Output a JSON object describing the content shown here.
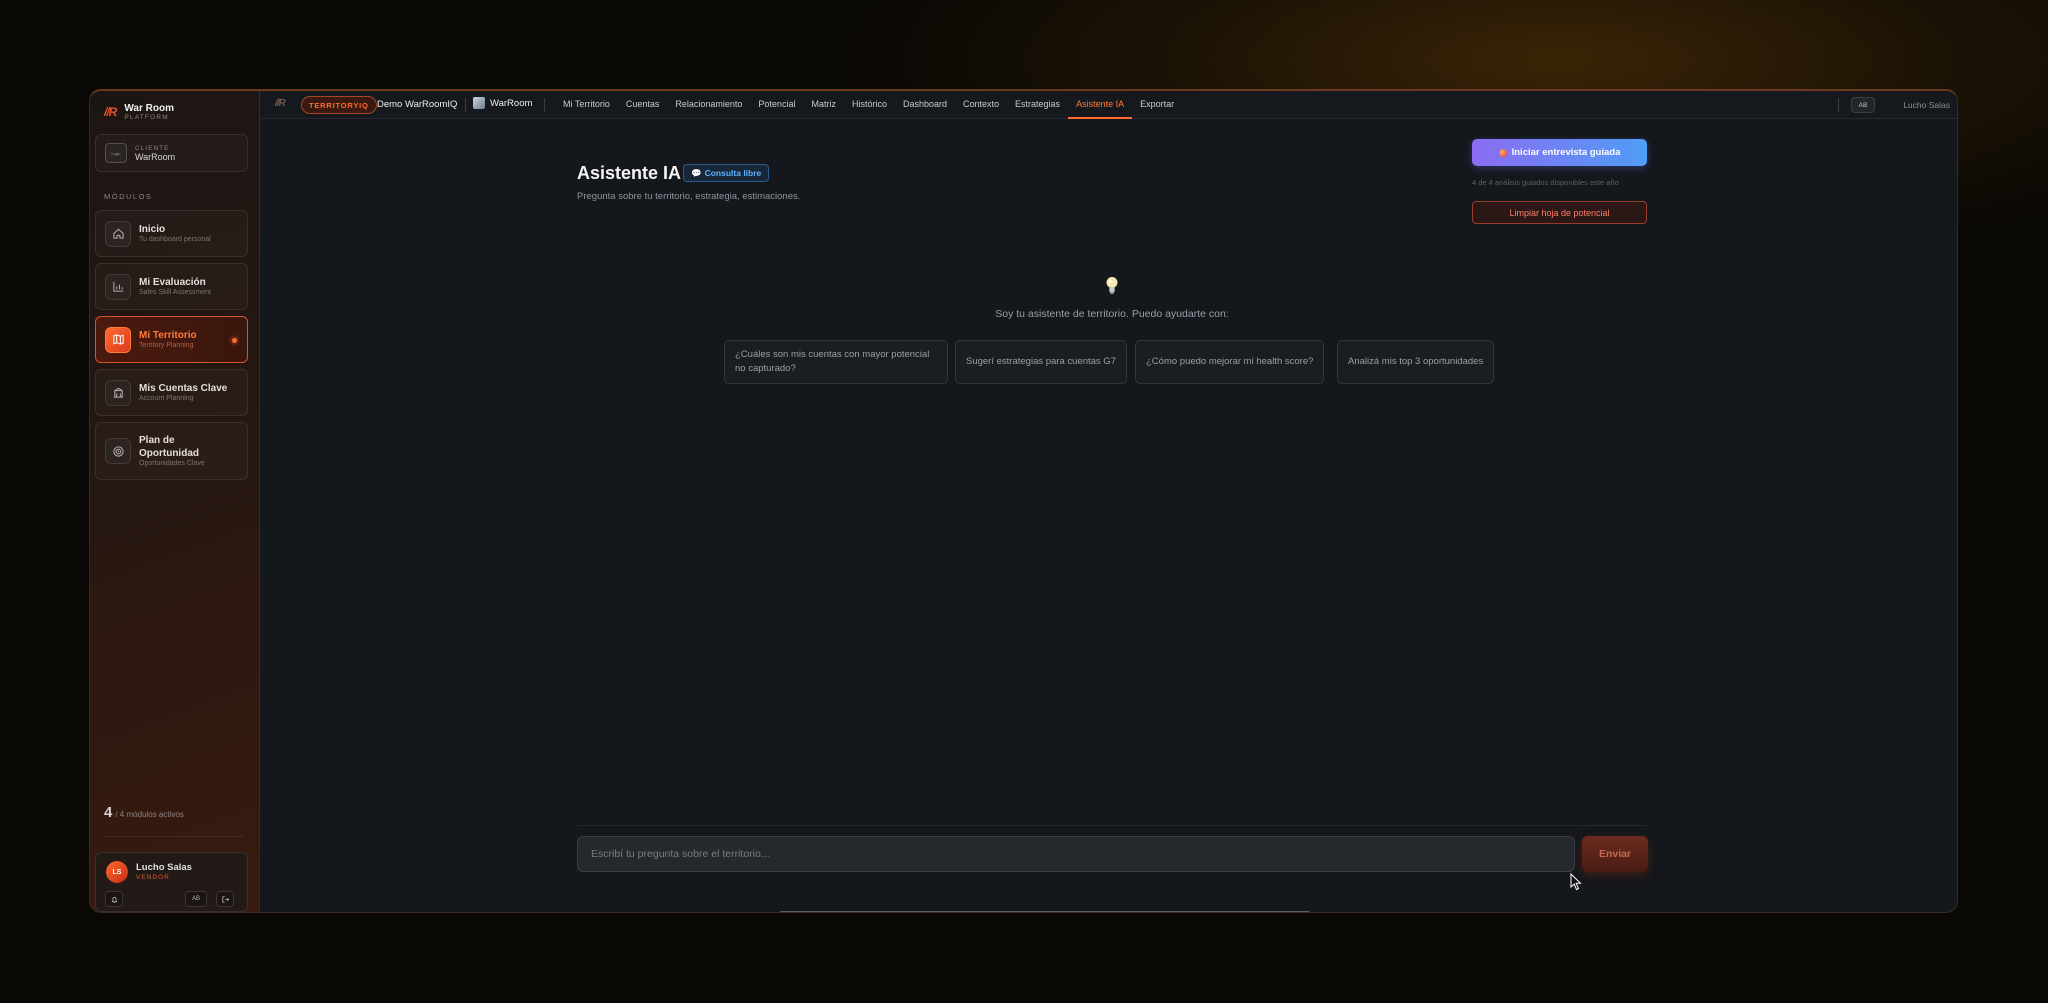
{
  "brand": {
    "title": "War Room",
    "subtitle": "PLATFORM",
    "mark": "//R"
  },
  "client": {
    "label": "CLIENTE",
    "name": "WarRoom",
    "logo_text": "Logo"
  },
  "sidebar": {
    "section_label": "MÓDULOS",
    "modules": [
      {
        "title": "Inicio",
        "subtitle": "Tu dashboard personal",
        "icon": "home-icon"
      },
      {
        "title": "Mi Evaluación",
        "subtitle": "Sales Skill Assessment",
        "icon": "bar-chart-icon"
      },
      {
        "title": "Mi Territorio",
        "subtitle": "Territory Planning",
        "icon": "map-icon",
        "active": true
      },
      {
        "title": "Mis Cuentas Clave",
        "subtitle": "Account Planning",
        "icon": "building-icon"
      },
      {
        "title": "Plan de Oportunidad",
        "subtitle": "Oportunidades Clave",
        "icon": "target-icon"
      }
    ],
    "modules_count": "4",
    "modules_total": "/ 4 módulos activos"
  },
  "user": {
    "initials": "LS",
    "name": "Lucho Salas",
    "role": "VENDOR",
    "lang": "AB"
  },
  "topbar": {
    "mark": "//R",
    "badge": "TERRITORYIQ",
    "project": "Demo WarRoomIQ",
    "client": "WarRoom",
    "nav": [
      "Mi Territorio",
      "Cuentas",
      "Relacionamiento",
      "Potencial",
      "Matriz",
      "Histórico",
      "Dashboard",
      "Contexto",
      "Estrategias",
      "Asistente IA",
      "Exportar"
    ],
    "active_nav": "Asistente IA",
    "lang": "AB",
    "user": "Lucho Salas"
  },
  "page": {
    "title": "Asistente IA",
    "badge": "Consulta libre",
    "subtitle": "Pregunta sobre tu territorio, estrategia, estimaciones.",
    "guided_button": "Iniciar entrevista guiada",
    "guided_note": "4 de 4 análisis guiados disponibles este año",
    "clear_button": "Limpiar hoja de potencial",
    "intro": "Soy tu asistente de territorio. Puedo ayudarte con:",
    "suggestions": [
      "¿Cuáles son mis cuentas con mayor potencial no capturado?",
      "Sugerí estrategias para cuentas G7",
      "¿Cómo puedo mejorar mi health score?",
      "Analizá mis top 3 oportunidades"
    ],
    "input_placeholder": "Escribí tu pregunta sobre el territorio...",
    "send_button": "Enviar"
  },
  "colors": {
    "accent": "#ff6a2e",
    "badge_blue": "#5eb2ff",
    "danger": "#ff7d6a"
  }
}
